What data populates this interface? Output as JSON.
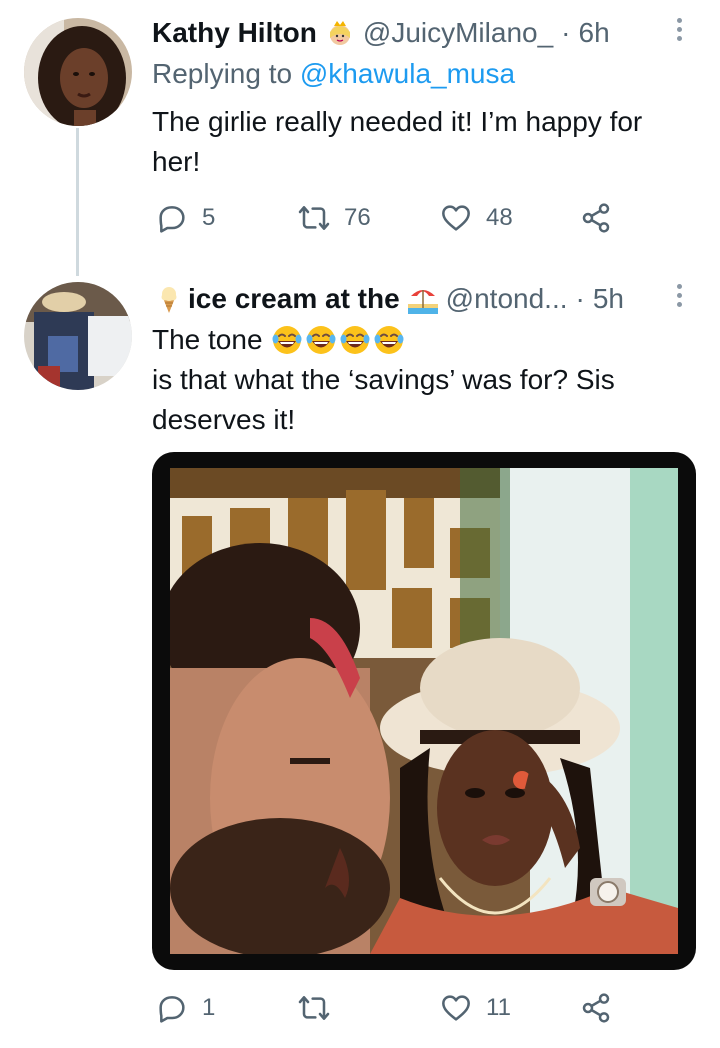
{
  "tweets": [
    {
      "name": "Kathy Hilton",
      "name_emoji": "princess-emoji",
      "handle": "@JuicyMilano_",
      "separator": "·",
      "time": "6h",
      "replying_prefix": "Replying to",
      "replying_to": "@khawula_musa",
      "text_lines": [
        "The girlie really needed it! I’m happy for",
        "her!"
      ],
      "actions": {
        "replies": "5",
        "retweets": "76",
        "likes": "48"
      }
    },
    {
      "name": "ice cream at the",
      "name_emoji_before": "ice-cream-emoji",
      "name_emoji_after": "beach-umbrella-emoji",
      "handle": "@ntond...",
      "separator": "·",
      "time": "5h",
      "text_first": "The tone",
      "text_emojis": [
        "joy-emoji",
        "joy-emoji",
        "joy-emoji",
        "joy-emoji"
      ],
      "text_lines": [
        "is that what the ‘savings’ was for? Sis",
        "deserves it!"
      ],
      "actions": {
        "replies": "1",
        "retweets": "",
        "likes": "11"
      }
    }
  ],
  "colors": {
    "text": "#0f1419",
    "secondary": "#536471",
    "link": "#1d9bf0",
    "thread_line": "#cfd9de"
  }
}
